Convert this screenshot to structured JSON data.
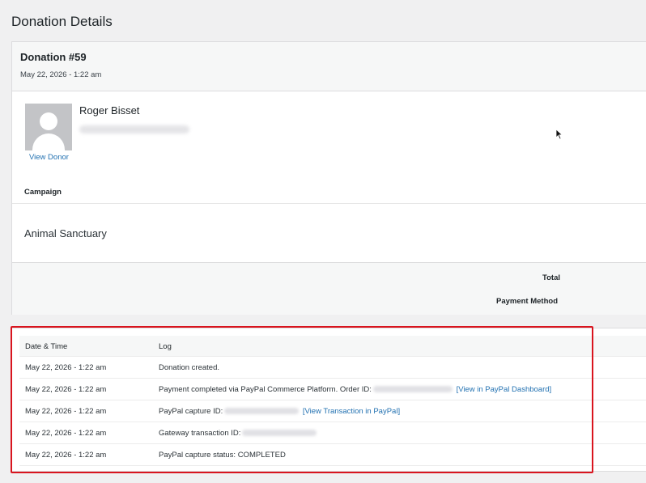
{
  "page": {
    "title": "Donation Details"
  },
  "donation": {
    "number": "Donation #59",
    "date": "May 22, 2026 - 1:22 am"
  },
  "donor": {
    "name": "Roger Bisset",
    "view_link": "View Donor"
  },
  "campaign": {
    "label": "Campaign",
    "name": "Animal Sanctuary"
  },
  "summary": {
    "total_label": "Total",
    "payment_method_label": "Payment Method"
  },
  "log": {
    "headers": {
      "date": "Date & Time",
      "log": "Log"
    },
    "rows": [
      {
        "date": "May 22, 2026 - 1:22 am",
        "text": "Donation created."
      },
      {
        "date": "May 22, 2026 - 1:22 am",
        "text": "Payment completed via PayPal Commerce Platform. Order ID:",
        "link": "[View in PayPal Dashboard]"
      },
      {
        "date": "May 22, 2026 - 1:22 am",
        "text": "PayPal capture ID:",
        "link": "[View Transaction in PayPal]"
      },
      {
        "date": "May 22, 2026 - 1:22 am",
        "text": "Gateway transaction ID:"
      },
      {
        "date": "May 22, 2026 - 1:22 am",
        "text": "PayPal capture status: COMPLETED"
      }
    ]
  },
  "colors": {
    "link": "#2271b1",
    "highlight": "#d9141e",
    "background": "#f0f0f1"
  }
}
